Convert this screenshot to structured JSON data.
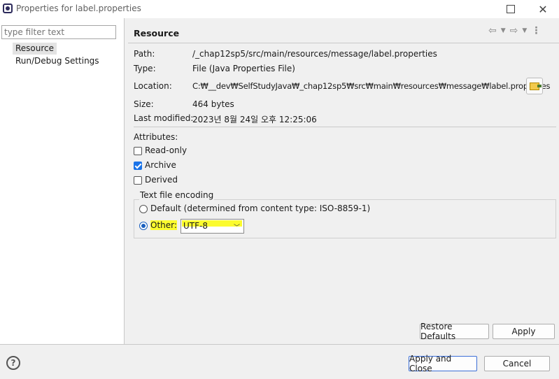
{
  "window": {
    "title": "Properties for label.properties"
  },
  "filter": {
    "placeholder": "type filter text"
  },
  "tree": {
    "items": [
      {
        "label": "Resource"
      },
      {
        "label": "Run/Debug Settings"
      }
    ]
  },
  "page": {
    "title": "Resource"
  },
  "info": {
    "path_label": "Path:",
    "path_value": "/_chap12sp5/src/main/resources/message/label.properties",
    "type_label": "Type:",
    "type_value": "File  (Java Properties File)",
    "location_label": "Location:",
    "location_value": "C:₩__dev₩SelfStudyJava₩_chap12sp5₩src₩main₩resources₩message₩label.properties",
    "size_label": "Size:",
    "size_value": "464  bytes",
    "modified_label": "Last modified:",
    "modified_value": "2023년 8월 24일 오후 12:25:06"
  },
  "attributes": {
    "title": "Attributes:",
    "readonly": {
      "label": "Read-only",
      "checked": false
    },
    "archive": {
      "label": "Archive",
      "checked": true
    },
    "derived": {
      "label": "Derived",
      "checked": false
    }
  },
  "encoding": {
    "title": "Text file encoding",
    "default_label": "Default (determined from content type: ISO-8859-1)",
    "other_label": "Other:",
    "selected": "UTF-8"
  },
  "buttons": {
    "restore": "Restore Defaults",
    "apply": "Apply",
    "apply_close": "Apply and Close",
    "cancel": "Cancel"
  },
  "colors": {
    "highlight": "#fbfb2e",
    "accent": "#1a73e8"
  }
}
